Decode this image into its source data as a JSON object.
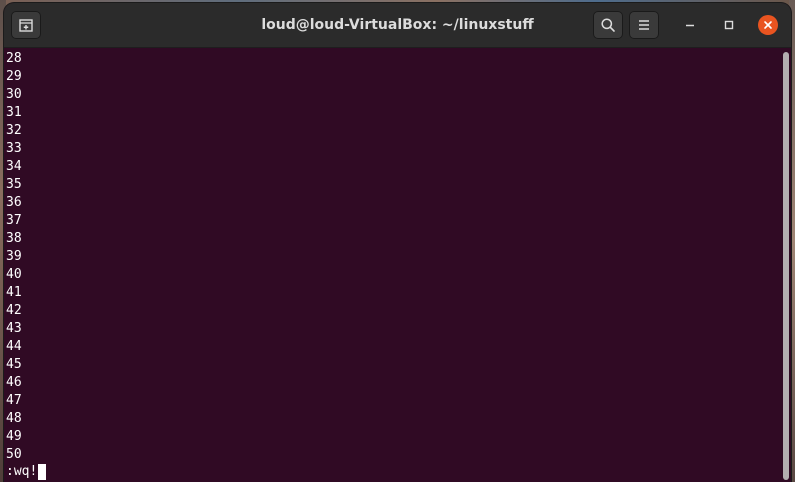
{
  "window": {
    "title": "loud@loud-VirtualBox: ~/linuxstuff"
  },
  "toolbar": {
    "new_tab_icon": "new-tab-icon",
    "search_icon": "search-icon",
    "menu_icon": "hamburger-menu-icon",
    "minimize_icon": "minimize-icon",
    "maximize_icon": "maximize-icon",
    "close_icon": "close-icon"
  },
  "colors": {
    "terminal_background": "#300a24",
    "terminal_text": "#ffffff",
    "titlebar": "#2b2b2b",
    "close_button": "#e95420"
  },
  "terminal": {
    "lines": [
      "28",
      "29",
      "30",
      "31",
      "32",
      "33",
      "34",
      "35",
      "36",
      "37",
      "38",
      "39",
      "40",
      "41",
      "42",
      "43",
      "44",
      "45",
      "46",
      "47",
      "48",
      "49",
      "50"
    ],
    "command_line": ":wq!"
  }
}
